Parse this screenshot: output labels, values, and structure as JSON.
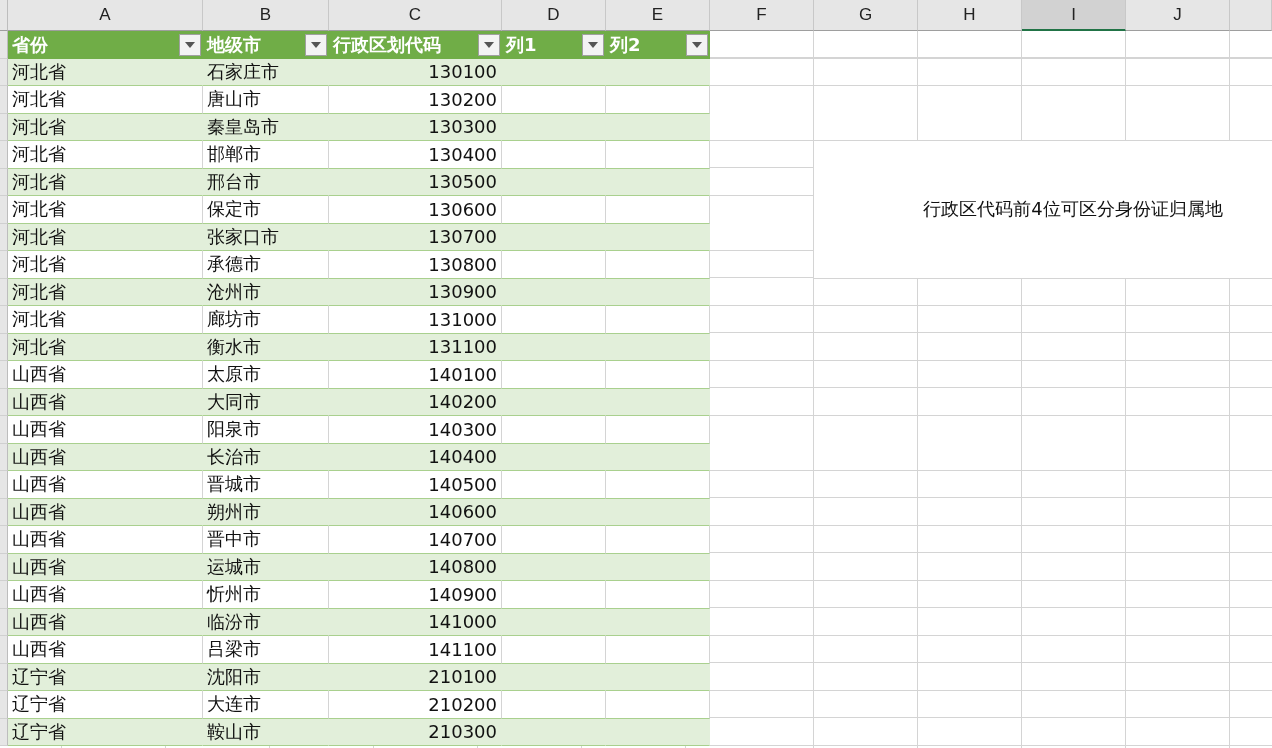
{
  "column_headers": [
    {
      "label": "A",
      "selected": false
    },
    {
      "label": "B",
      "selected": false
    },
    {
      "label": "C",
      "selected": false
    },
    {
      "label": "D",
      "selected": false
    },
    {
      "label": "E",
      "selected": false
    },
    {
      "label": "F",
      "selected": false
    },
    {
      "label": "G",
      "selected": false
    },
    {
      "label": "H",
      "selected": false
    },
    {
      "label": "I",
      "selected": true
    },
    {
      "label": "J",
      "selected": false
    }
  ],
  "table": {
    "columns": [
      {
        "label": "省份"
      },
      {
        "label": "地级市"
      },
      {
        "label": "行政区划代码"
      },
      {
        "label": "列1"
      },
      {
        "label": "列2"
      }
    ],
    "rows": [
      {
        "province": "河北省",
        "city": "石家庄市",
        "code": "130100"
      },
      {
        "province": "河北省",
        "city": "唐山市",
        "code": "130200"
      },
      {
        "province": "河北省",
        "city": "秦皇岛市",
        "code": "130300"
      },
      {
        "province": "河北省",
        "city": "邯郸市",
        "code": "130400"
      },
      {
        "province": "河北省",
        "city": "邢台市",
        "code": "130500"
      },
      {
        "province": "河北省",
        "city": "保定市",
        "code": "130600"
      },
      {
        "province": "河北省",
        "city": "张家口市",
        "code": "130700"
      },
      {
        "province": "河北省",
        "city": "承德市",
        "code": "130800"
      },
      {
        "province": "河北省",
        "city": "沧州市",
        "code": "130900"
      },
      {
        "province": "河北省",
        "city": "廊坊市",
        "code": "131000"
      },
      {
        "province": "河北省",
        "city": "衡水市",
        "code": "131100"
      },
      {
        "province": "山西省",
        "city": "太原市",
        "code": "140100"
      },
      {
        "province": "山西省",
        "city": "大同市",
        "code": "140200"
      },
      {
        "province": "山西省",
        "city": "阳泉市",
        "code": "140300"
      },
      {
        "province": "山西省",
        "city": "长治市",
        "code": "140400"
      },
      {
        "province": "山西省",
        "city": "晋城市",
        "code": "140500"
      },
      {
        "province": "山西省",
        "city": "朔州市",
        "code": "140600"
      },
      {
        "province": "山西省",
        "city": "晋中市",
        "code": "140700"
      },
      {
        "province": "山西省",
        "city": "运城市",
        "code": "140800"
      },
      {
        "province": "山西省",
        "city": "忻州市",
        "code": "140900"
      },
      {
        "province": "山西省",
        "city": "临汾市",
        "code": "141000"
      },
      {
        "province": "山西省",
        "city": "吕梁市",
        "code": "141100"
      },
      {
        "province": "辽宁省",
        "city": "沈阳市",
        "code": "210100"
      },
      {
        "province": "辽宁省",
        "city": "大连市",
        "code": "210200"
      },
      {
        "province": "辽宁省",
        "city": "鞍山市",
        "code": "210300"
      }
    ]
  },
  "note": "行政区代码前4位可区分身份证归属地"
}
